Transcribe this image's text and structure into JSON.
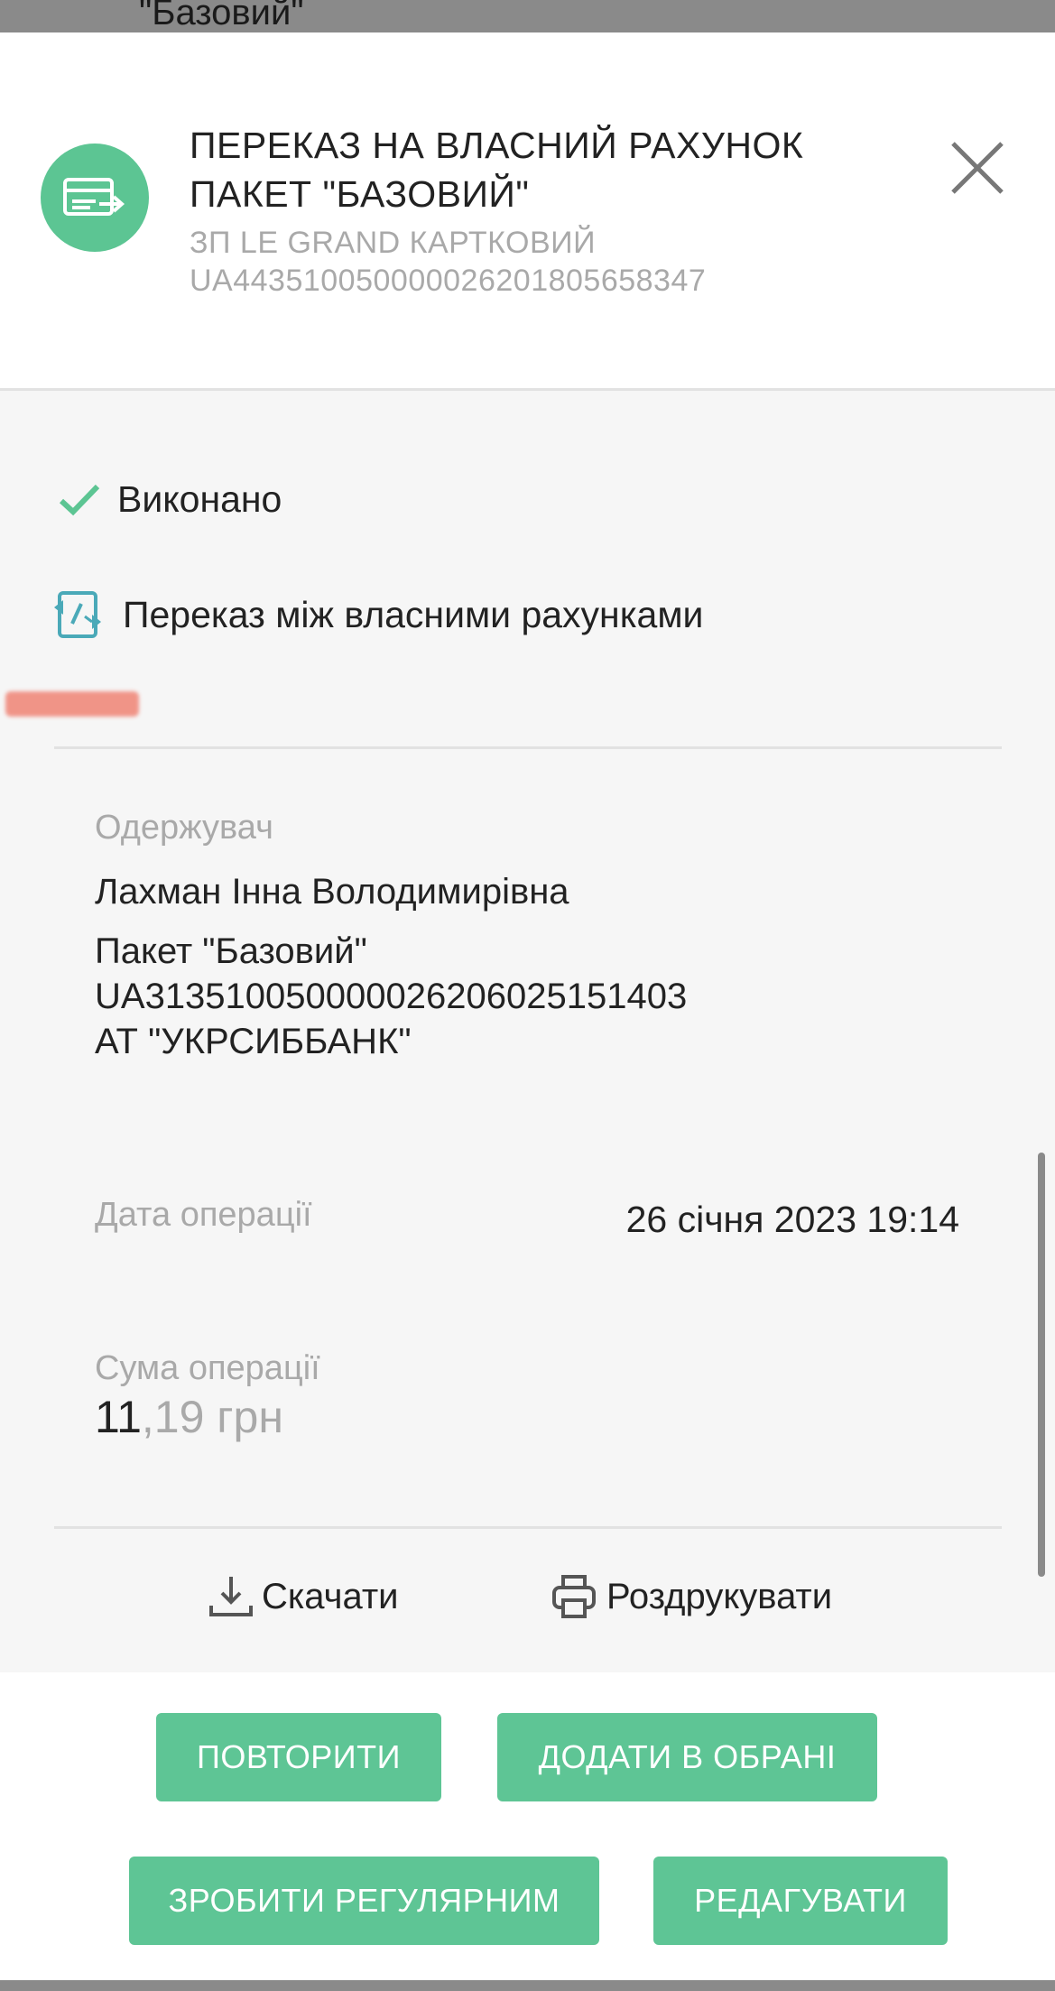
{
  "backdrop": {
    "peek_text": "\"Базовий\""
  },
  "header": {
    "title_line1": "ПЕРЕКАЗ НА ВЛАСНИЙ РАХУНОК",
    "title_line2": "ПАКЕТ \"БАЗОВИЙ\"",
    "account_name": "ЗП LE GRAND КАРТКОВИЙ",
    "account_iban": "UA443510050000026201805658347",
    "icon": "card-transfer-icon",
    "close_icon": "close-icon",
    "accent": "#5cc593"
  },
  "details": {
    "status": "Виконано",
    "status_icon": "check-icon",
    "status_color": "#5cc593",
    "type": "Переказ між власними рахунками",
    "type_icon": "own-transfer-icon",
    "recipient_label": "Одержувач",
    "recipient_name": "Лахман Інна Володимирівна",
    "recipient_package": "Пакет \"Базовий\"",
    "recipient_iban": "UA313510050000026206025151403",
    "recipient_bank": "АТ \"УКРСИББАНК\"",
    "date_label": "Дата операції",
    "date_value": "26 січня 2023 19:14",
    "amount_label": "Сума операції",
    "amount_integer": "11",
    "amount_decimal": ",19 грн"
  },
  "actions": {
    "download_label": "Скачати",
    "download_icon": "download-icon",
    "print_label": "Роздрукувати",
    "print_icon": "printer-icon"
  },
  "buttons": {
    "repeat": "ПОВТОРИТИ",
    "add_favorite": "ДОДАТИ В ОБРАНІ",
    "make_regular": "ЗРОБИТИ РЕГУЛЯРНИМ",
    "edit": "РЕДАГУВАТИ",
    "color": "#5ec595"
  }
}
